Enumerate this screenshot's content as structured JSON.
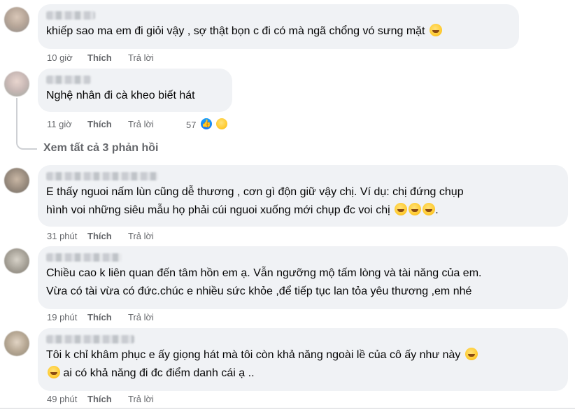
{
  "comments": [
    {
      "lines": [
        "khiếp sao ma em đi giỏi vậy , sợ thật bọn c đi có mà ngã chổng vó sưng mặt"
      ],
      "trailing_emoji": "grinning-face-emoji",
      "time": "10 giờ",
      "like_label": "Thích",
      "reply_label": "Trả lời"
    },
    {
      "lines": [
        "Nghệ nhân đi cà kheo biết hát"
      ],
      "time": "11 giờ",
      "like_label": "Thích",
      "reply_label": "Trả lời",
      "reaction_count": "57",
      "reactions": [
        "like-reaction-icon",
        "haha-reaction-icon"
      ]
    },
    {
      "lines": [
        "E thấy nguoi nấm lùn cũng dễ thương , cơn gì độn giữ vậy chị. Ví dụ: chị đứng chụp",
        "hình voi những siêu mẫu họ phải cúi nguoi xuống mới chụp đc voi chị"
      ],
      "trailing_emoji": "rofl-emoji x3",
      "time": "31 phút",
      "like_label": "Thích",
      "reply_label": "Trả lời"
    },
    {
      "lines": [
        "Chiều cao k liên quan đến tâm hồn em ạ. Vẫn ngưỡng mộ tấm lòng và tài năng của em.",
        "Vừa có tài vừa có đức.chúc e nhiều sức khỏe ,để tiếp tục lan tỏa yêu thương ,em nhé"
      ],
      "time": "19 phút",
      "like_label": "Thích",
      "reply_label": "Trả lời"
    },
    {
      "lines": [
        "Tôi k chỉ khâm phục e ấy giọng hát mà tôi còn khả năng ngoài lề của cô ấy như này",
        "ai có khả năng đi đc điểm danh cái ạ .."
      ],
      "trailing_emoji": "rofl-emoji",
      "time": "49 phút",
      "like_label": "Thích",
      "reply_label": "Trả lời"
    }
  ],
  "view_replies": "Xem tất cả 3 phản hồi",
  "colors": {
    "bubble": "#f0f2f5",
    "meta_text": "#65676b",
    "like_reaction": "#1877f2",
    "haha_reaction": "#ffcc33"
  }
}
